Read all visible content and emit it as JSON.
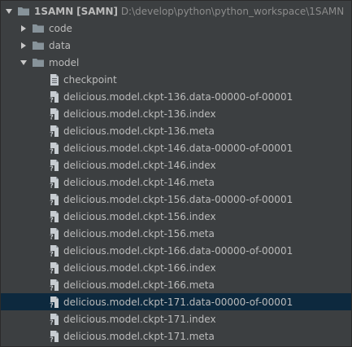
{
  "tree": {
    "root": {
      "name": "1SAMN",
      "module": "[SAMN]",
      "path": "D:\\develop\\python\\python_workspace\\1SAMN",
      "expanded": true
    },
    "folders": [
      {
        "label": "code",
        "expanded": false
      },
      {
        "label": "data",
        "expanded": false
      },
      {
        "label": "model",
        "expanded": true
      }
    ],
    "files": [
      {
        "label": "checkpoint",
        "icon": "text-file-icon"
      },
      {
        "label": "delicious.model.ckpt-136.data-00000-of-00001",
        "icon": "unknown-file-icon"
      },
      {
        "label": "delicious.model.ckpt-136.index",
        "icon": "unknown-file-icon"
      },
      {
        "label": "delicious.model.ckpt-136.meta",
        "icon": "unknown-file-icon"
      },
      {
        "label": "delicious.model.ckpt-146.data-00000-of-00001",
        "icon": "unknown-file-icon"
      },
      {
        "label": "delicious.model.ckpt-146.index",
        "icon": "unknown-file-icon"
      },
      {
        "label": "delicious.model.ckpt-146.meta",
        "icon": "unknown-file-icon"
      },
      {
        "label": "delicious.model.ckpt-156.data-00000-of-00001",
        "icon": "unknown-file-icon"
      },
      {
        "label": "delicious.model.ckpt-156.index",
        "icon": "unknown-file-icon"
      },
      {
        "label": "delicious.model.ckpt-156.meta",
        "icon": "unknown-file-icon"
      },
      {
        "label": "delicious.model.ckpt-166.data-00000-of-00001",
        "icon": "unknown-file-icon"
      },
      {
        "label": "delicious.model.ckpt-166.index",
        "icon": "unknown-file-icon"
      },
      {
        "label": "delicious.model.ckpt-166.meta",
        "icon": "unknown-file-icon"
      },
      {
        "label": "delicious.model.ckpt-171.data-00000-of-00001",
        "icon": "unknown-file-icon",
        "selected": true
      },
      {
        "label": "delicious.model.ckpt-171.index",
        "icon": "unknown-file-icon"
      },
      {
        "label": "delicious.model.ckpt-171.meta",
        "icon": "unknown-file-icon"
      }
    ]
  },
  "colors": {
    "background": "#3c3f41",
    "text": "#bbbbbb",
    "path_text": "#8c8c8c",
    "selection": "#0d293e",
    "folder_icon": "#87939a"
  }
}
